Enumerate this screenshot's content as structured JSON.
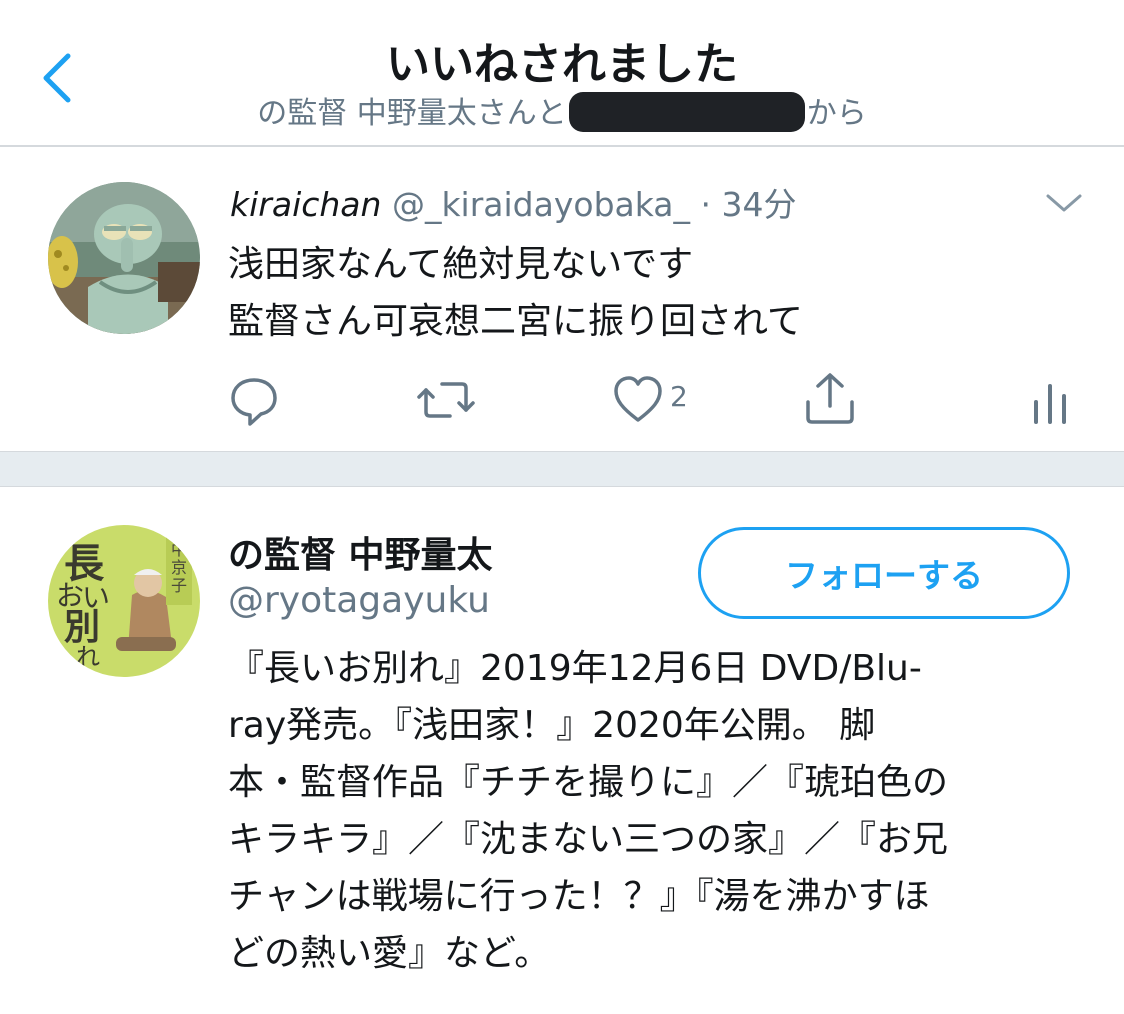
{
  "header": {
    "title": "いいねされました",
    "subtitle_before": "の監督 中野量太さんと",
    "subtitle_after": "から",
    "back_icon": "chevron-left-icon"
  },
  "tweet": {
    "display_name": "kiraichan",
    "handle": "@_kiraidayobaka_",
    "separator": "·",
    "time": "34分",
    "text_lines": [
      "浅田家なんて絶対見ないです",
      "監督さん可哀想二宮に振り回されて"
    ],
    "like_count": "2",
    "actions": [
      "reply-icon",
      "retweet-icon",
      "like-icon",
      "share-icon",
      "analytics-icon"
    ]
  },
  "profile": {
    "name": "の監督 中野量太",
    "handle": "@ryotagayuku",
    "follow_label": "フォローする",
    "bio_lines": [
      "『長いお別れ』2019年12月6日 DVD/Blu-",
      "ray発売。『浅田家！』2020年公開。 脚",
      "本・監督作品『チチを撮りに』／『琥珀色の",
      "キラキラ』／『沈まない三つの家』／『お兄",
      "チャンは戦場に行った！？』『湯を沸かすほ",
      "どの熱い愛』など。"
    ],
    "avatar_text": {
      "main": "長い",
      "sub": "お別れ",
      "side": "中島京子"
    }
  },
  "colors": {
    "accent": "#1da1f2",
    "secondary_text": "#657786",
    "divider_bg": "#e6ecf0"
  }
}
